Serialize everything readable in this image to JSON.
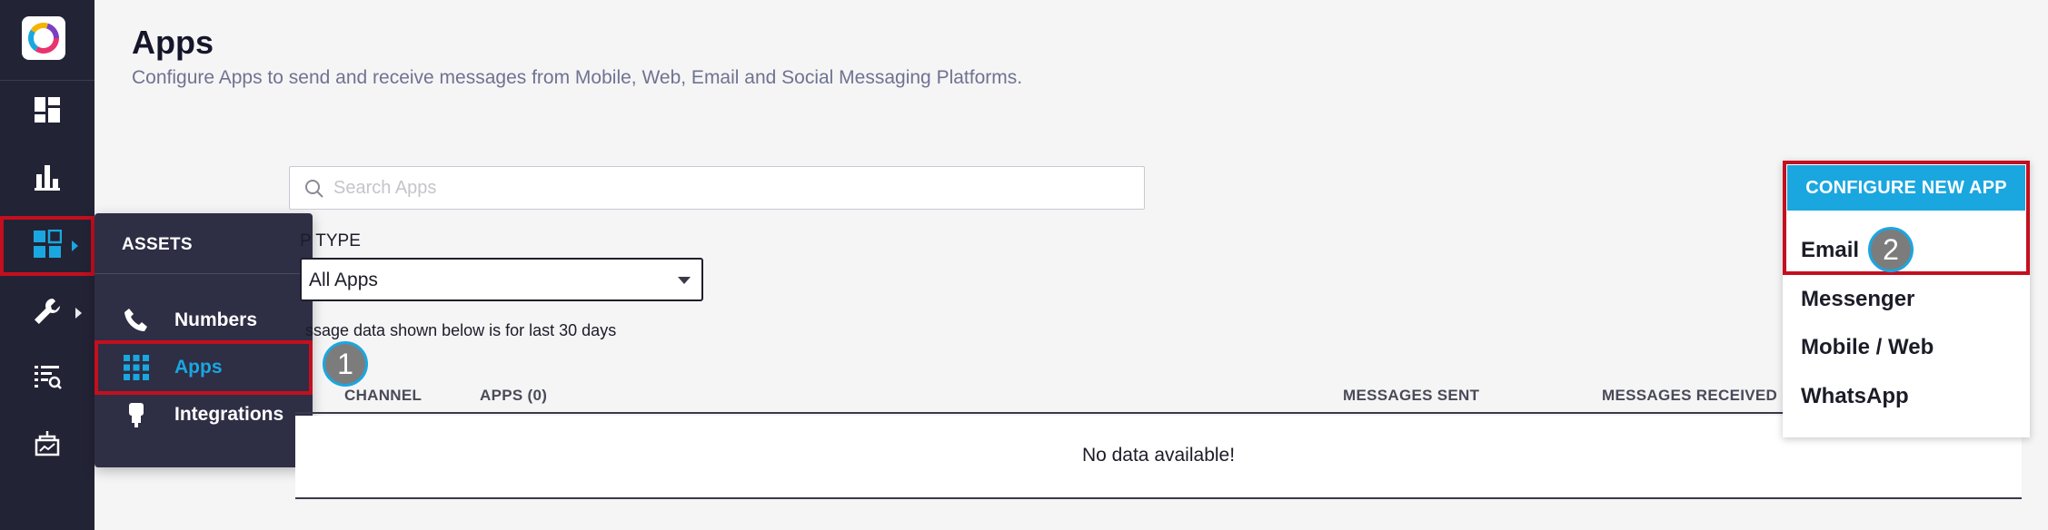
{
  "rail": {
    "items": [
      {
        "name": "dashboard-icon"
      },
      {
        "name": "analytics-icon"
      },
      {
        "name": "assets-icon"
      },
      {
        "name": "wrench-icon"
      },
      {
        "name": "logs-icon"
      },
      {
        "name": "sandbox-icon"
      }
    ]
  },
  "flyout": {
    "title": "ASSETS",
    "items": [
      {
        "label": "Numbers",
        "icon": "phone-icon"
      },
      {
        "label": "Apps",
        "icon": "apps-grid-icon"
      },
      {
        "label": "Integrations",
        "icon": "plug-icon"
      }
    ]
  },
  "steps": {
    "one": "1",
    "two": "2"
  },
  "page": {
    "title": "Apps",
    "subtitle": "Configure Apps to send and receive messages from Mobile, Web, Email and Social Messaging Platforms."
  },
  "search": {
    "placeholder": "Search Apps",
    "value": ""
  },
  "filter": {
    "label": "P TYPE",
    "selected": "All Apps"
  },
  "note": "ssage data shown below is for last 30 days",
  "table": {
    "columns": [
      "CHANNEL",
      "APPS (0)",
      "MESSAGES SENT",
      "MESSAGES RECEIVED"
    ],
    "empty": "No data available!"
  },
  "configure": {
    "button": "CONFIGURE NEW APP",
    "options": [
      "Email",
      "Messenger",
      "Mobile / Web",
      "WhatsApp"
    ]
  },
  "colors": {
    "accent": "#1aa7e0",
    "highlight": "#c40f1e",
    "rail": "#232336"
  }
}
